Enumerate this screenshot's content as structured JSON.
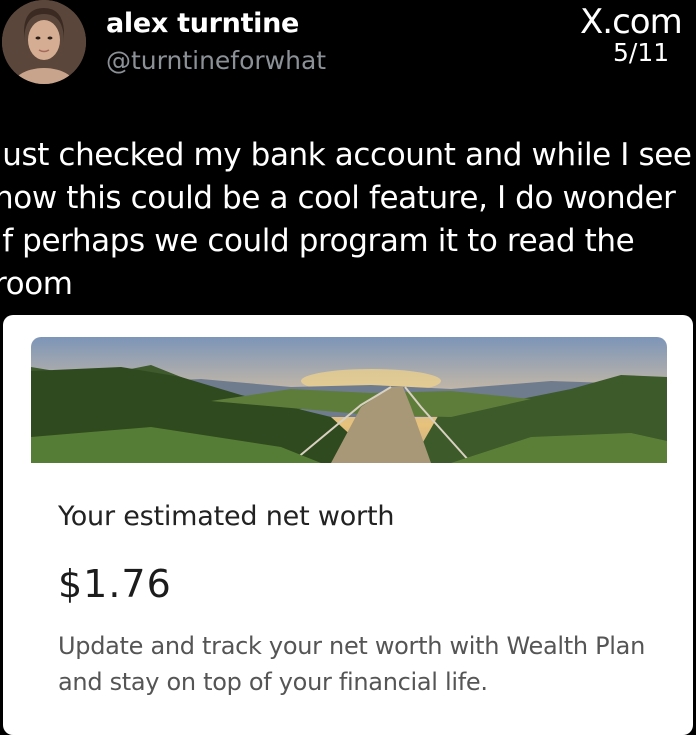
{
  "tweet": {
    "author_name": "alex turntine",
    "author_handle": "@turntineforwhat",
    "site_logo": "X.com",
    "page_counter": "5/11",
    "text": "just checked my bank account and while I see how this could be a cool feature, I do wonder if perhaps we could program it to read the room"
  },
  "card": {
    "title": "Your estimated net worth",
    "value": "$1.76",
    "description": "Update and track your net worth with Wealth Plan and stay on top of your financial life."
  },
  "icons": {
    "avatar": "profile-avatar",
    "logo": "x-logo-icon",
    "banner": "landscape-banner-image"
  }
}
